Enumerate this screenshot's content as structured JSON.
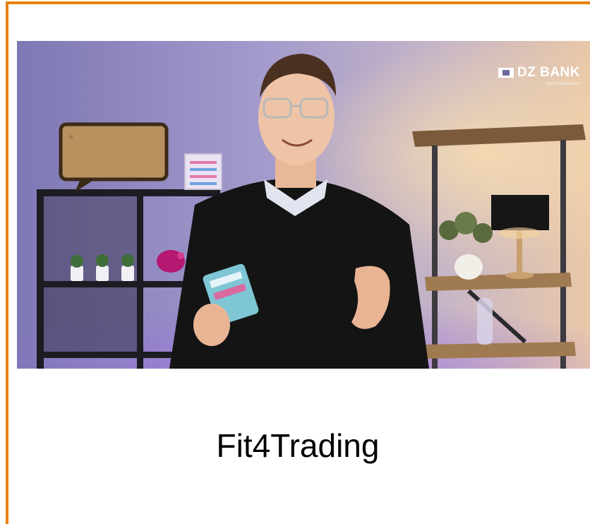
{
  "card": {
    "title": "Fit4Trading",
    "border_color": "#e8820a"
  },
  "thumbnail": {
    "logo": {
      "name": "DZ BANK",
      "tagline": "Die Initiativbank",
      "icon": "dz-bank-logo-icon"
    },
    "colors": {
      "wall": "#8f88bd",
      "warm_light": "#f0c890",
      "sweater": "#141414",
      "shelf_wood": "#8a6a48"
    }
  }
}
